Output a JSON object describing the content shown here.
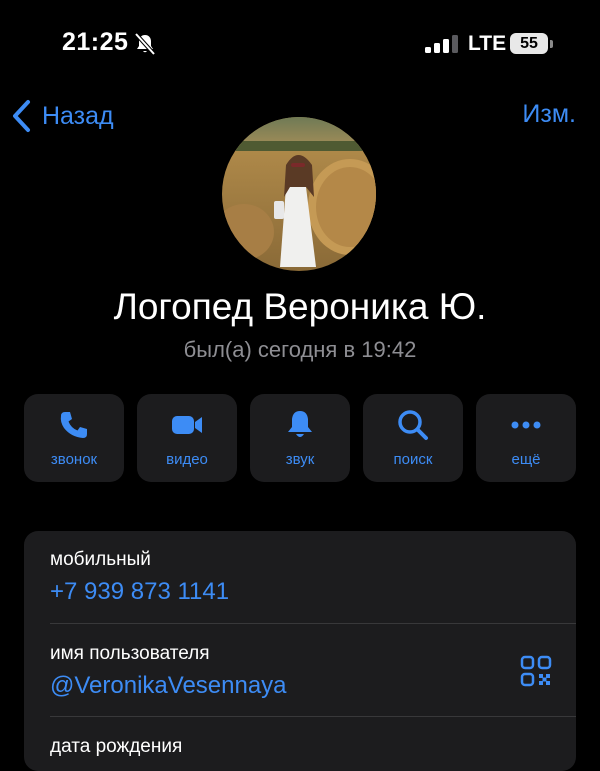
{
  "status_bar": {
    "time": "21:25",
    "network": "LTE",
    "battery": "55"
  },
  "nav": {
    "back_label": "Назад",
    "edit_label": "Изм."
  },
  "profile": {
    "name": "Логопед Вероника Ю.",
    "status": "был(а) сегодня в 19:42"
  },
  "actions": [
    {
      "label": "звонок",
      "icon": "phone-icon"
    },
    {
      "label": "видео",
      "icon": "video-camera-icon"
    },
    {
      "label": "звук",
      "icon": "bell-icon"
    },
    {
      "label": "поиск",
      "icon": "search-icon"
    },
    {
      "label": "ещё",
      "icon": "more-icon"
    }
  ],
  "info": {
    "mobile_label": "мобильный",
    "mobile_value": "+7 939 873 1141",
    "username_label": "имя пользователя",
    "username_value": "@VeronikaVesennaya",
    "birthday_label": "дата рождения"
  },
  "colors": {
    "background": "#000000",
    "accent": "#3d8cf5",
    "card": "#1c1c1e",
    "secondary_text": "#8e8e93"
  }
}
